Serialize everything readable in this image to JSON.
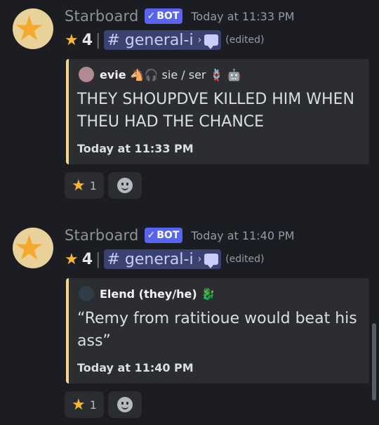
{
  "messages": [
    {
      "username": "Starboard",
      "bot_tag": "BOT",
      "timestamp": "Today at 11:33 PM",
      "star_count": "4",
      "channel": "# general-i",
      "edited": "(edited)",
      "embed": {
        "author": "evie",
        "author_decoration": "🐴🎧 sie / ser 🪢 🤖",
        "description": "THEY SHOUPDVE KILLED HIM WHEN THEU HAD THE CHANCE",
        "footer": "Today at 11:33 PM",
        "accent_color": "#f0d78a"
      },
      "reaction_count": "1"
    },
    {
      "username": "Starboard",
      "bot_tag": "BOT",
      "timestamp": "Today at 11:40 PM",
      "star_count": "4",
      "channel": "# general-i",
      "edited": "(edited)",
      "embed": {
        "author": "Elend (they/he)",
        "author_decoration": "🐉",
        "description": "“Remy from ratitioue would beat his ass”",
        "footer": "Today at 11:40 PM",
        "accent_color": "#f0d78a"
      },
      "reaction_count": "1"
    }
  ],
  "icons": {
    "avatar": "star-avatar-icon",
    "star": "star-emoji-icon",
    "thread": "speech-bubble-icon",
    "add_reaction": "add-reaction-icon"
  },
  "colors": {
    "background": "#1c1d22",
    "bot_tag": "#5865f2",
    "mention_bg": "#3c4270",
    "embed_bg": "#2b2d31",
    "star": "#f7b731"
  }
}
